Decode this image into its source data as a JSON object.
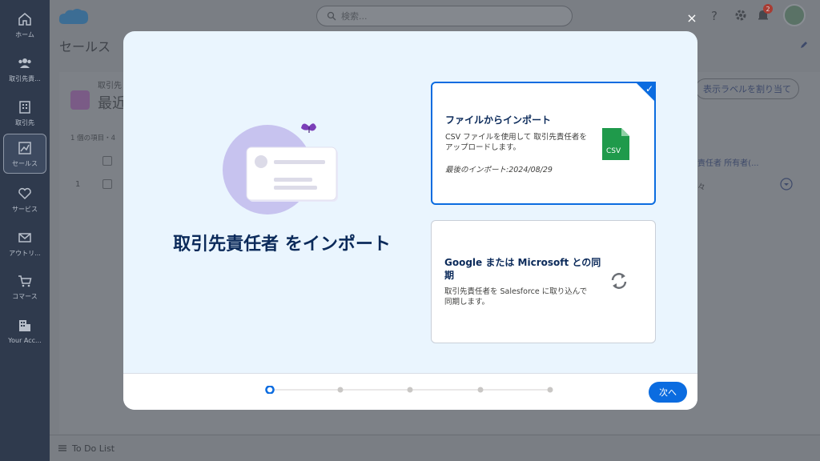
{
  "rail": {
    "items": [
      {
        "label": "ホーム"
      },
      {
        "label": "取引先責..."
      },
      {
        "label": "取引先"
      },
      {
        "label": "セールス"
      },
      {
        "label": "サービス"
      },
      {
        "label": "アウトリ..."
      },
      {
        "label": "コマース"
      },
      {
        "label": "Your Acc..."
      }
    ]
  },
  "header": {
    "search_placeholder": "検索...",
    "notification_count": "2",
    "app_name": "セールス"
  },
  "background": {
    "breadcrumb": "取引先",
    "title_partial": "最近",
    "items_count": "1 個の項目・4",
    "row_number": "1",
    "assign_label_button": "表示ラベルを割り当て",
    "column_owner": "責任者 所有者(...",
    "cell_partial": "々"
  },
  "modal": {
    "title": "取引先責任者 をインポート",
    "close_label": "×",
    "next_button": "次へ",
    "steps_total": 5,
    "current_step": 1,
    "options": [
      {
        "title": "ファイルからインポート",
        "description": "CSV ファイルを使用して 取引先責任者をアップロードします。",
        "meta": "最後のインポート:2024/08/29",
        "icon": "csv-file-icon",
        "icon_text": "CSV",
        "selected": true
      },
      {
        "title": "Google または Microsoft との同期",
        "description": "取引先責任者を Salesforce に取り込んで同期します。",
        "icon": "sync-icon",
        "selected": false
      }
    ]
  },
  "footer": {
    "todo_label": "To Do List"
  },
  "colors": {
    "brand_blue": "#0b6ce0",
    "title_navy": "#0b2a5a",
    "modal_bg": "#eaf5fe"
  }
}
